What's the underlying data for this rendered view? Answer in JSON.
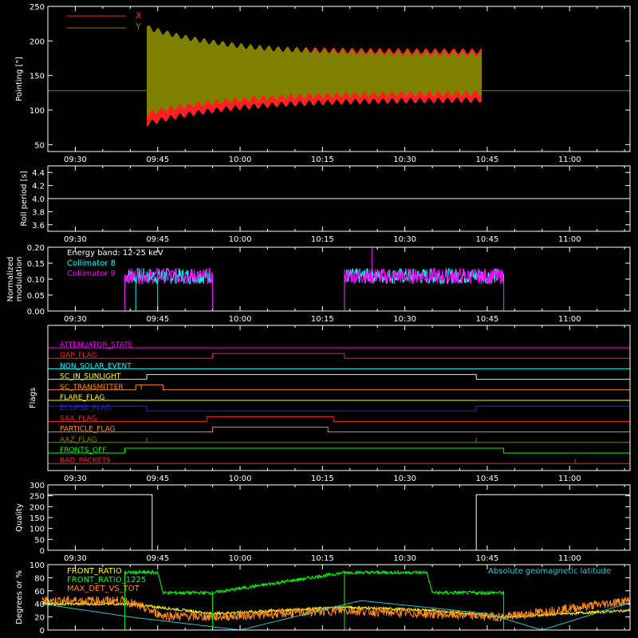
{
  "colors": {
    "background": "#000000",
    "axes": "#ffffff",
    "x_pointing": "#ff2020",
    "y_pointing": "#808000",
    "roll": "#ffffff",
    "collimator8": "#00ffff",
    "collimator9": "#ff00ff",
    "quality": "#ffffff",
    "front_ratio": "#ffff00",
    "front_ratio_1225": "#00ff00",
    "max_det_vs_tot": "#ff8c1a",
    "geomag_lat": "#20c8d0"
  },
  "time_axis": {
    "tick_labels": [
      "09:30",
      "09:45",
      "10:00",
      "10:15",
      "10:30",
      "10:45",
      "11:00"
    ],
    "tick_minutes": [
      570,
      585,
      600,
      615,
      630,
      645,
      660
    ],
    "range_minutes": [
      565,
      671
    ]
  },
  "panels": {
    "pointing": {
      "ylabel": "Pointing [\"]",
      "yticks": [
        "50",
        "100",
        "150",
        "200",
        "250"
      ],
      "ylim": [
        40,
        250
      ],
      "legend": [
        "X",
        "Y"
      ]
    },
    "roll": {
      "ylabel": "Roll period [s]",
      "yticks": [
        "3.6",
        "3.8",
        "4.0",
        "4.2",
        "4.4"
      ],
      "ylim": [
        3.5,
        4.5
      ]
    },
    "modulation": {
      "ylabel_line1": "Normalized",
      "ylabel_line2": "modulation",
      "yticks": [
        "0.00",
        "0.05",
        "0.10",
        "0.15",
        "0.20"
      ],
      "ylim": [
        0,
        0.2
      ],
      "energy_band": "Energy band:  12-25 keV",
      "legend": [
        "Collimator 8",
        "Collimator 9"
      ]
    },
    "flags": {
      "ylabel": "Flags"
    },
    "quality": {
      "ylabel": "Quality",
      "yticks": [
        "0",
        "50",
        "100",
        "150",
        "200",
        "250",
        "300"
      ],
      "ylim": [
        0,
        300
      ]
    },
    "ratios": {
      "ylabel": "Degrees or %",
      "yticks": [
        "0",
        "20",
        "40",
        "60",
        "80",
        "100"
      ],
      "ylim": [
        0,
        100
      ],
      "legend": [
        "FRONT_RATIO",
        "FRONT_RATIO_1225",
        "MAX_DET_VS_TOT"
      ],
      "right_legend": "Absolute geomagnetic latitude"
    }
  },
  "chart_data": [
    {
      "type": "area",
      "title": "",
      "ylabel": "Pointing [\"]",
      "ylim": [
        40,
        250
      ],
      "x_range": [
        "09:24",
        "11:11"
      ],
      "series": [
        {
          "name": "X",
          "baseline_before_and_after": 128,
          "active_window": [
            "09:43",
            "10:44"
          ],
          "upper_envelope_start_to_end": [
            200,
            185
          ],
          "lower_envelope_start_to_end": [
            80,
            115
          ]
        },
        {
          "name": "Y",
          "baseline_before_and_after": 128,
          "active_window": [
            "09:43",
            "10:44"
          ],
          "upper_envelope_start_to_end": [
            220,
            180
          ],
          "lower_envelope_start_to_end": [
            95,
            125
          ]
        }
      ]
    },
    {
      "type": "line",
      "ylabel": "Roll period [s]",
      "ylim": [
        3.5,
        4.5
      ],
      "series": [
        {
          "values": [
            4.0,
            4.0
          ],
          "x": [
            "09:24",
            "11:11"
          ]
        }
      ]
    },
    {
      "type": "line",
      "ylabel": "Normalized modulation",
      "ylim": [
        0,
        0.2
      ],
      "series": [
        {
          "name": "Collimator 8",
          "segments": [
            {
              "from": "09:39",
              "to": "09:55",
              "mean": 0.11
            },
            {
              "from": "10:19",
              "to": "10:48",
              "mean": 0.11
            }
          ]
        },
        {
          "name": "Collimator 9",
          "segments": [
            {
              "from": "09:39",
              "to": "09:55",
              "mean": 0.11
            },
            {
              "from": "10:19",
              "to": "10:48",
              "mean": 0.11
            }
          ]
        }
      ]
    },
    {
      "type": "line",
      "ylabel": "Flags",
      "series": [
        {
          "name": "ATTENUATOR_STATE",
          "color": "#ff00ff",
          "steps": [
            [
              "09:24",
              0
            ]
          ]
        },
        {
          "name": "GAP_FLAG",
          "color": "#ff2020",
          "steps": [
            [
              "09:24",
              0
            ],
            [
              "09:55",
              1
            ],
            [
              "10:19",
              0
            ]
          ]
        },
        {
          "name": "NON_SOLAR_EVENT",
          "color": "#00ffff",
          "steps": [
            [
              "09:24",
              0
            ]
          ]
        },
        {
          "name": "SC_IN_SUNLIGHT",
          "color": "#ffff00",
          "steps": [
            [
              "09:24",
              0
            ],
            [
              "09:43",
              1
            ],
            [
              "10:43",
              0
            ]
          ]
        },
        {
          "name": "SC_TRANSMITTER",
          "color": "#ff8c1a",
          "steps": [
            [
              "09:24",
              0
            ],
            [
              "09:41",
              1
            ],
            [
              "09:42",
              0
            ],
            [
              "09:42",
              1
            ],
            [
              "09:46",
              0
            ]
          ]
        },
        {
          "name": "FLARE_FLAG",
          "color": "#ffff00",
          "steps": [
            [
              "09:24",
              0
            ]
          ]
        },
        {
          "name": "ECLIPSE_FLAG",
          "color": "#2020ff",
          "steps": [
            [
              "09:24",
              1
            ],
            [
              "09:43",
              0
            ],
            [
              "10:43",
              1
            ]
          ]
        },
        {
          "name": "SAA_FLAG",
          "color": "#ff2020",
          "steps": [
            [
              "09:24",
              0
            ],
            [
              "09:54",
              1
            ],
            [
              "10:17",
              0
            ]
          ]
        },
        {
          "name": "PARTICLE_FLAG",
          "color": "#ff8c1a",
          "steps": [
            [
              "09:24",
              0
            ],
            [
              "09:55",
              1
            ],
            [
              "10:16",
              0
            ]
          ]
        },
        {
          "name": "AAZ_FLAG",
          "color": "#808000",
          "steps": [
            [
              "09:24",
              0
            ],
            [
              "09:43",
              1
            ],
            [
              "09:43",
              0
            ],
            [
              "10:43",
              1
            ],
            [
              "10:43",
              0
            ]
          ]
        },
        {
          "name": "FRONTS_OFF",
          "color": "#00ff00",
          "steps": [
            [
              "09:24",
              0
            ],
            [
              "09:39",
              1
            ],
            [
              "10:48",
              0
            ]
          ]
        },
        {
          "name": "BAD_PACKETS",
          "color": "#ff2020",
          "steps": [
            [
              "09:24",
              0
            ],
            [
              "11:01",
              1
            ],
            [
              "11:01",
              0
            ]
          ]
        }
      ]
    },
    {
      "type": "line",
      "ylabel": "Quality",
      "ylim": [
        0,
        300
      ],
      "series": [
        {
          "steps": [
            [
              "09:24",
              255
            ],
            [
              "09:44",
              0
            ],
            [
              "10:43",
              255
            ],
            [
              "11:11",
              255
            ]
          ]
        }
      ]
    },
    {
      "type": "line",
      "ylabel": "Degrees or %",
      "ylim": [
        0,
        100
      ],
      "series": [
        {
          "name": "FRONT_RATIO",
          "approx": [
            [
              "09:24",
              40
            ],
            [
              "09:39",
              40
            ],
            [
              "09:45",
              35
            ],
            [
              "09:55",
              25
            ],
            [
              "10:19",
              35
            ],
            [
              "10:35",
              30
            ],
            [
              "10:48",
              20
            ],
            [
              "11:11",
              30
            ]
          ]
        },
        {
          "name": "FRONT_RATIO_1225",
          "approx": [
            [
              "09:39",
              88
            ],
            [
              "09:45",
              88
            ],
            [
              "09:46",
              57
            ],
            [
              "09:55",
              57
            ],
            [
              "10:19",
              88
            ],
            [
              "10:34",
              88
            ],
            [
              "10:35",
              57
            ],
            [
              "10:48",
              57
            ]
          ]
        },
        {
          "name": "MAX_DET_VS_TOT",
          "approx": [
            [
              "09:24",
              45
            ],
            [
              "09:39",
              45
            ],
            [
              "09:46",
              22
            ],
            [
              "09:55",
              20
            ],
            [
              "10:19",
              30
            ],
            [
              "10:48",
              20
            ],
            [
              "11:11",
              45
            ]
          ]
        },
        {
          "name": "Absolute geomagnetic latitude",
          "approx": [
            [
              "09:24",
              40
            ],
            [
              "09:40",
              20
            ],
            [
              "10:00",
              0
            ],
            [
              "10:22",
              45
            ],
            [
              "10:45",
              25
            ],
            [
              "10:55",
              0
            ],
            [
              "11:11",
              42
            ]
          ]
        }
      ]
    }
  ]
}
